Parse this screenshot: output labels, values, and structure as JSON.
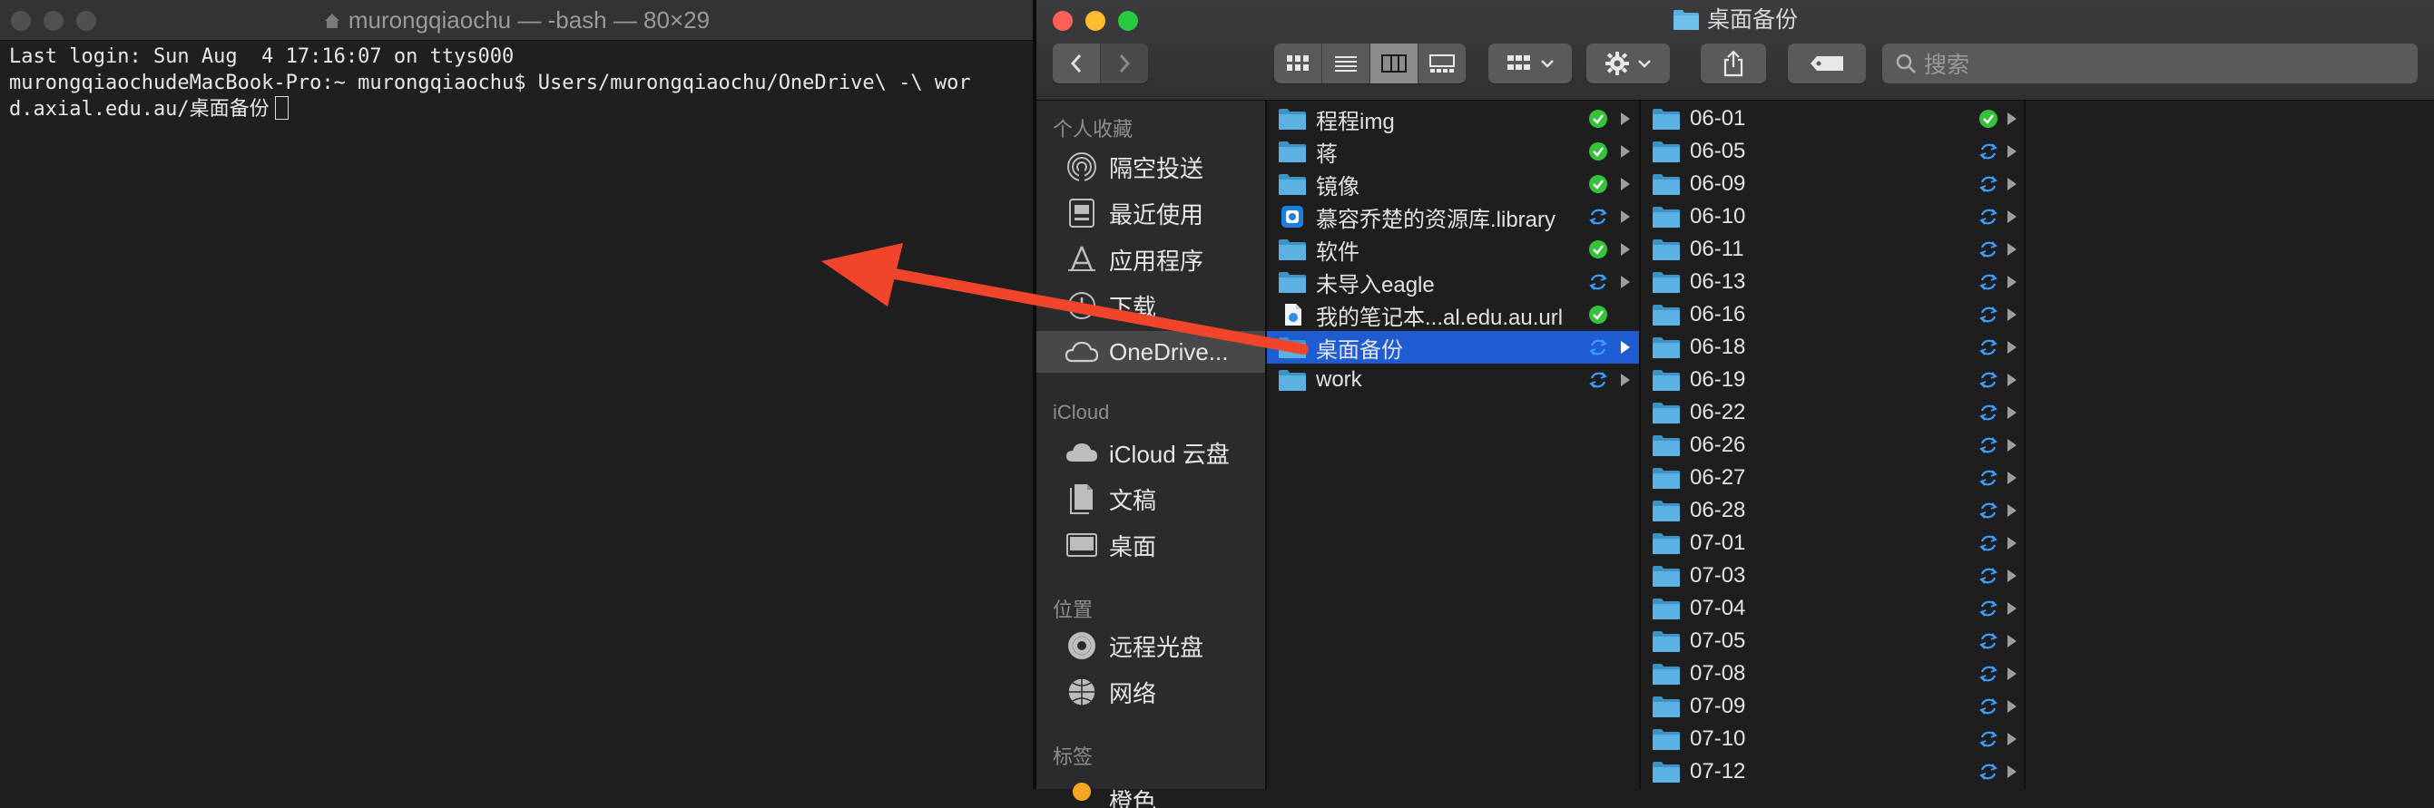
{
  "terminal": {
    "title": "murongqiaochu — -bash — 80×29",
    "lines": [
      "Last login: Sun Aug  4 17:16:07 on ttys000",
      "murongqiaochudeMacBook-Pro:~ murongqiaochu$ Users/murongqiaochu/OneDrive\\ -\\ wor",
      "d.axial.edu.au/桌面备份"
    ]
  },
  "finder": {
    "title": "桌面备份",
    "search_placeholder": "搜索",
    "sidebar": {
      "favorites_header": "个人收藏",
      "favorites": [
        {
          "label": "隔空投送",
          "icon": "airdrop-icon"
        },
        {
          "label": "最近使用",
          "icon": "recents-icon"
        },
        {
          "label": "应用程序",
          "icon": "applications-icon"
        },
        {
          "label": "下载",
          "icon": "downloads-icon"
        },
        {
          "label": "OneDrive...",
          "icon": "cloud-icon",
          "selected": true
        }
      ],
      "icloud_header": "iCloud",
      "icloud": [
        {
          "label": "iCloud 云盘",
          "icon": "icloud-icon"
        },
        {
          "label": "文稿",
          "icon": "documents-icon"
        },
        {
          "label": "桌面",
          "icon": "desktop-icon"
        }
      ],
      "locations_header": "位置",
      "locations": [
        {
          "label": "远程光盘",
          "icon": "disc-icon"
        },
        {
          "label": "网络",
          "icon": "network-icon"
        }
      ],
      "tags_header": "标签",
      "tags": [
        {
          "label": "橙色",
          "icon": "orange-tag-icon"
        }
      ]
    },
    "column1": [
      {
        "name": "程程img",
        "type": "folder",
        "status": "synced"
      },
      {
        "name": "蒋",
        "type": "folder",
        "status": "synced"
      },
      {
        "name": "镜像",
        "type": "folder",
        "status": "synced"
      },
      {
        "name": "慕容乔楚的资源库.library",
        "type": "library",
        "status": "syncing"
      },
      {
        "name": "软件",
        "type": "folder",
        "status": "synced"
      },
      {
        "name": "未导入eagle",
        "type": "folder",
        "status": "syncing"
      },
      {
        "name": "我的笔记本...al.edu.au.url",
        "type": "file",
        "status": "synced"
      },
      {
        "name": "桌面备份",
        "type": "folder",
        "status": "syncing",
        "selected": true
      },
      {
        "name": "work",
        "type": "folder",
        "status": "syncing"
      }
    ],
    "column2": [
      {
        "name": "06-01",
        "status": "synced"
      },
      {
        "name": "06-05",
        "status": "syncing"
      },
      {
        "name": "06-09",
        "status": "syncing"
      },
      {
        "name": "06-10",
        "status": "syncing"
      },
      {
        "name": "06-11",
        "status": "syncing"
      },
      {
        "name": "06-13",
        "status": "syncing"
      },
      {
        "name": "06-16",
        "status": "syncing"
      },
      {
        "name": "06-18",
        "status": "syncing"
      },
      {
        "name": "06-19",
        "status": "syncing"
      },
      {
        "name": "06-22",
        "status": "syncing"
      },
      {
        "name": "06-26",
        "status": "syncing"
      },
      {
        "name": "06-27",
        "status": "syncing"
      },
      {
        "name": "06-28",
        "status": "syncing"
      },
      {
        "name": "07-01",
        "status": "syncing"
      },
      {
        "name": "07-03",
        "status": "syncing"
      },
      {
        "name": "07-04",
        "status": "syncing"
      },
      {
        "name": "07-05",
        "status": "syncing"
      },
      {
        "name": "07-08",
        "status": "syncing"
      },
      {
        "name": "07-09",
        "status": "syncing"
      },
      {
        "name": "07-10",
        "status": "syncing"
      },
      {
        "name": "07-12",
        "status": "syncing"
      }
    ],
    "colors": {
      "selection": "#1f5bd1",
      "synced": "#35c13a",
      "syncing": "#3aa0ff",
      "folder": "#4da7d9",
      "annotation_arrow": "#f0452a"
    }
  }
}
